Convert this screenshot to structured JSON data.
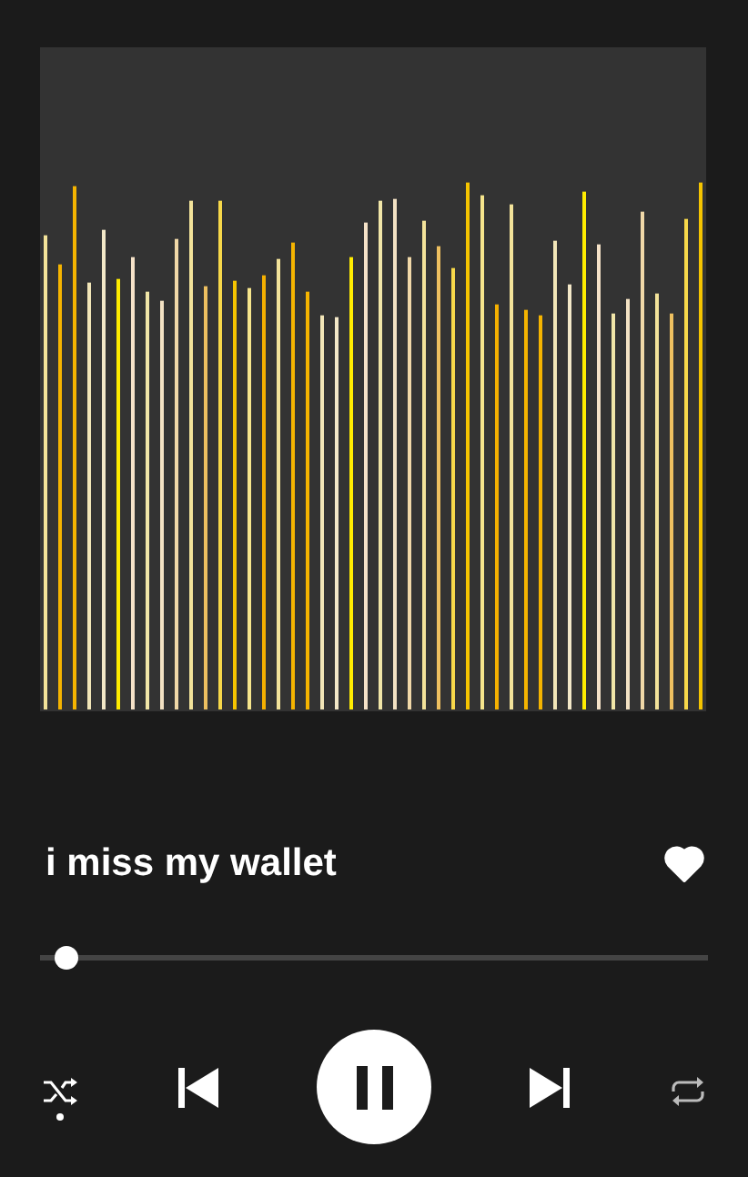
{
  "track": {
    "title": "i miss my wallet",
    "liked": true
  },
  "progress": {
    "level": 0.02
  },
  "controls": {
    "shuffle_on": true,
    "playing": true,
    "repeat_on": false
  }
}
